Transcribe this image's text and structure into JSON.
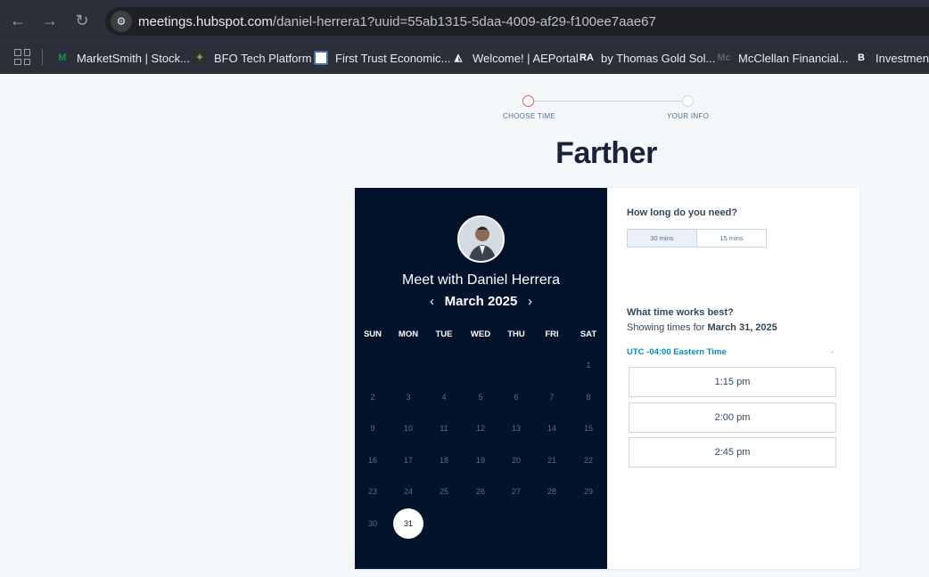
{
  "browser": {
    "url_domain": "meetings.hubspot.com",
    "url_path": "/daniel-herrera1?uuid=55ab1315-5daa-4009-af29-f100ee7aae67",
    "back_icon": "←",
    "forward_icon": "→",
    "reload_icon": "↻",
    "bookmarks": [
      {
        "label": "MarketSmith | Stock...",
        "icon_text": "M",
        "icon_color": "#1e8e3e"
      },
      {
        "label": "BFO Tech Platform",
        "icon_text": "✦",
        "icon_color": "#b08d3c"
      },
      {
        "label": "First Trust Economic...",
        "icon_text": "",
        "icon_color": "#ffffff"
      },
      {
        "label": "Welcome! | AEPortal",
        "icon_text": "◭",
        "icon_color": "#ffffff"
      },
      {
        "label": "by Thomas Gold Sol...",
        "icon_text": "RA",
        "icon_color": "#ffffff"
      },
      {
        "label": "McClellan Financial...",
        "icon_text": "Mc",
        "icon_color": "#5f6368"
      },
      {
        "label": "Investments",
        "icon_text": "B",
        "icon_color": "#ffffff"
      }
    ]
  },
  "steps": {
    "step1": "CHOOSE TIME",
    "step2": "YOUR INFO"
  },
  "brand": {
    "logo_text": "Farther"
  },
  "calendar": {
    "title": "Meet with Daniel Herrera",
    "month": "March 2025",
    "prev": "‹",
    "next": "›",
    "weekdays": [
      "SUN",
      "MON",
      "TUE",
      "WED",
      "THU",
      "FRI",
      "SAT"
    ],
    "first_weekday": 6,
    "days_in_month": 31,
    "available_days": [
      31
    ]
  },
  "booking": {
    "duration_question": "How long do you need?",
    "durations": [
      "30 mins",
      "15 mins"
    ],
    "selected_duration": "30 mins",
    "time_question": "What time works best?",
    "showing_prefix": "Showing times for",
    "showing_date": "March 31, 2025",
    "timezone": "UTC -04:00 Eastern Time",
    "timezone_caret": "-",
    "slots": [
      "1:15 pm",
      "2:00 pm",
      "2:45 pm"
    ]
  },
  "colors": {
    "accent": "#f2545b",
    "dark": "#04132c",
    "link": "#0091ae"
  }
}
